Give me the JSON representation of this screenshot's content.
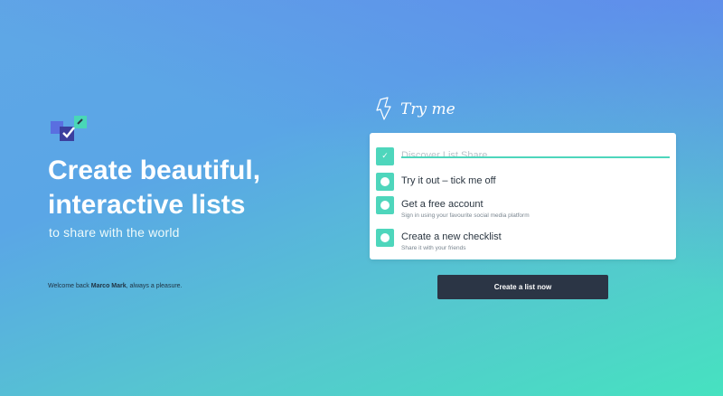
{
  "brand": {
    "logo_icon": "checklist-logo-icon"
  },
  "hero": {
    "title_line1": "Create beautiful,",
    "title_line2": "interactive lists",
    "subtitle": "to share with the world"
  },
  "welcome": {
    "prefix": "Welcome back ",
    "name": "Marco Mark",
    "suffix": ", always a pleasure."
  },
  "try_me": {
    "text": "Try me",
    "icon": "lightning-arrow-icon"
  },
  "checklist": {
    "items": [
      {
        "title": "Discover List Share",
        "subtitle": "",
        "checked": true
      },
      {
        "title": "Try it out – tick me off",
        "subtitle": "",
        "checked": false
      },
      {
        "title": "Get a free account",
        "subtitle": "Sign in using your favourite social media platform",
        "checked": false
      },
      {
        "title": "Create a new checklist",
        "subtitle": "Share it with your friends",
        "checked": false
      }
    ]
  },
  "cta": {
    "label": "Create a list now"
  },
  "colors": {
    "accent": "#4ed6bc",
    "button_bg": "#2b3545",
    "gradient_top": "#5b84ee",
    "gradient_bottom": "#46e2c0"
  }
}
